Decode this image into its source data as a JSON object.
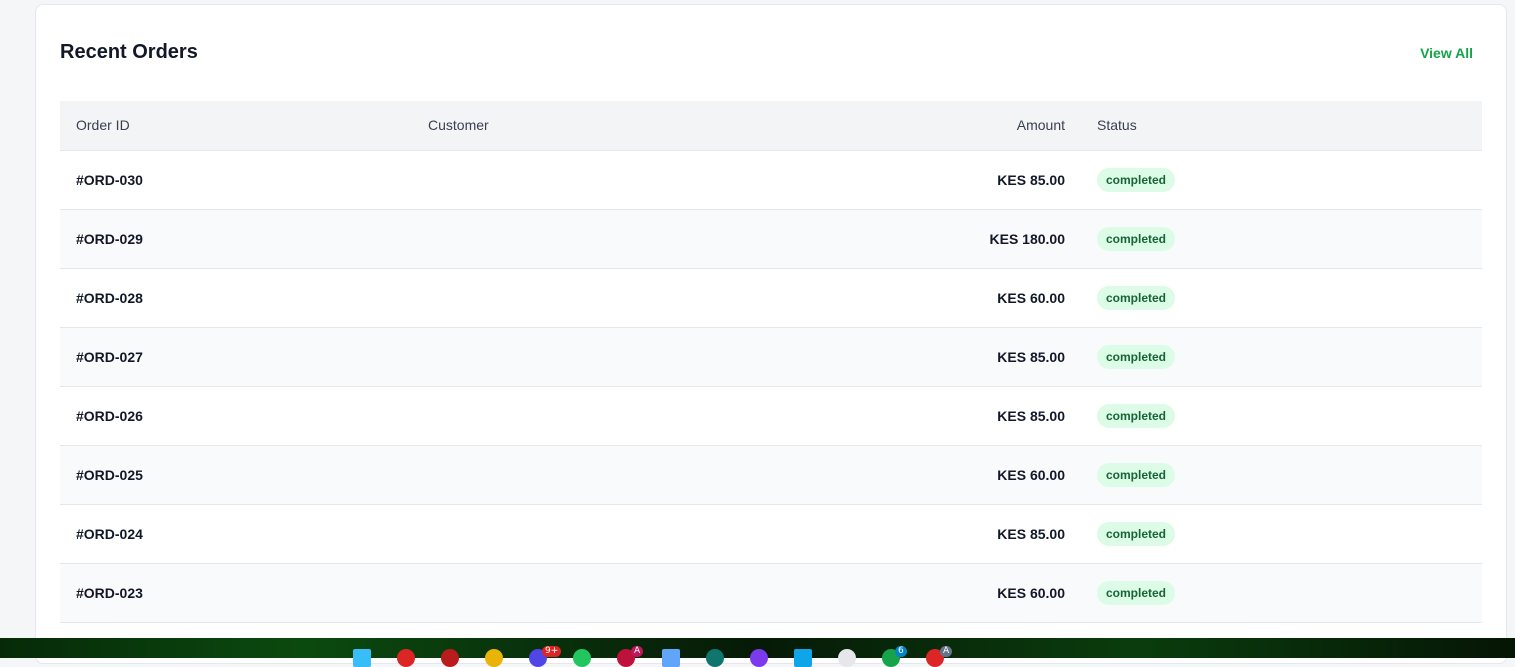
{
  "card": {
    "title": "Recent Orders",
    "view_all_label": "View All"
  },
  "table": {
    "headers": {
      "order_id": "Order ID",
      "customer": "Customer",
      "amount": "Amount",
      "status": "Status"
    },
    "rows": [
      {
        "order_id": "#ORD-030",
        "customer": "",
        "amount": "KES 85.00",
        "status": "completed"
      },
      {
        "order_id": "#ORD-029",
        "customer": "",
        "amount": "KES 180.00",
        "status": "completed"
      },
      {
        "order_id": "#ORD-028",
        "customer": "",
        "amount": "KES 60.00",
        "status": "completed"
      },
      {
        "order_id": "#ORD-027",
        "customer": "",
        "amount": "KES 85.00",
        "status": "completed"
      },
      {
        "order_id": "#ORD-026",
        "customer": "",
        "amount": "KES 85.00",
        "status": "completed"
      },
      {
        "order_id": "#ORD-025",
        "customer": "",
        "amount": "KES 60.00",
        "status": "completed"
      },
      {
        "order_id": "#ORD-024",
        "customer": "",
        "amount": "KES 85.00",
        "status": "completed"
      },
      {
        "order_id": "#ORD-023",
        "customer": "",
        "amount": "KES 60.00",
        "status": "completed"
      }
    ]
  },
  "colors": {
    "accent": "#16a34a",
    "badge_bg": "#dcfce7",
    "badge_text": "#166534"
  },
  "taskbar": {
    "badges": [
      "9+",
      "6",
      "A",
      "A"
    ]
  }
}
